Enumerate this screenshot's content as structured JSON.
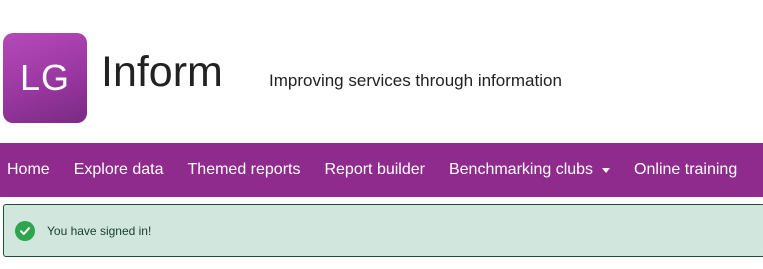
{
  "header": {
    "logo_initials": "LG",
    "logo_word": "Inform",
    "tagline": "Improving services through information"
  },
  "nav": {
    "items": [
      {
        "label": "Home"
      },
      {
        "label": "Explore data"
      },
      {
        "label": "Themed reports"
      },
      {
        "label": "Report builder"
      },
      {
        "label": "Benchmarking clubs",
        "dropdown": true
      },
      {
        "label": "Online training"
      }
    ]
  },
  "alert": {
    "icon": "check-circle-icon",
    "message": "You have signed in!"
  },
  "colors": {
    "brand_purple": "#8f2b8c",
    "alert_background": "#d1e7dd",
    "success_green": "#2ea44f"
  }
}
